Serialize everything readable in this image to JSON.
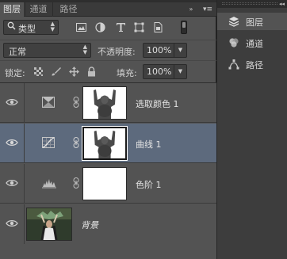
{
  "tabs": [
    {
      "label": "图层",
      "active": true
    },
    {
      "label": "通道",
      "active": false
    },
    {
      "label": "路径",
      "active": false
    }
  ],
  "tab_icons": {
    "collapse": "»",
    "menu": "▾≡"
  },
  "filter": {
    "label": "类型",
    "icon": "search-icon",
    "icons": [
      "image-filter-icon",
      "adjustment-filter-icon",
      "type-filter-icon",
      "shape-filter-icon",
      "smart-object-filter-icon"
    ]
  },
  "blend": {
    "mode": "正常",
    "opacity_label": "不透明度:",
    "opacity_value": "100%"
  },
  "lock": {
    "label": "锁定:",
    "icons": [
      "lock-transparent-icon",
      "lock-paint-icon",
      "lock-position-icon",
      "lock-all-icon"
    ],
    "fill_label": "填充:",
    "fill_value": "100%"
  },
  "layers": [
    {
      "name": "选取颜色 1",
      "type": "selective-color",
      "visible": true,
      "selected": false
    },
    {
      "name": "曲线 1",
      "type": "curves",
      "visible": true,
      "selected": true
    },
    {
      "name": "色阶 1",
      "type": "levels",
      "visible": true,
      "selected": false
    },
    {
      "name": "背景",
      "type": "background",
      "visible": true,
      "selected": false
    }
  ],
  "dock": [
    {
      "label": "图层",
      "icon": "layers-icon",
      "active": true
    },
    {
      "label": "通道",
      "icon": "channels-icon",
      "active": false
    },
    {
      "label": "路径",
      "icon": "paths-icon",
      "active": false
    }
  ],
  "colors": {
    "panel": "#535353",
    "selected_row": "#5d6a7d",
    "dock": "#3d3d3d"
  }
}
